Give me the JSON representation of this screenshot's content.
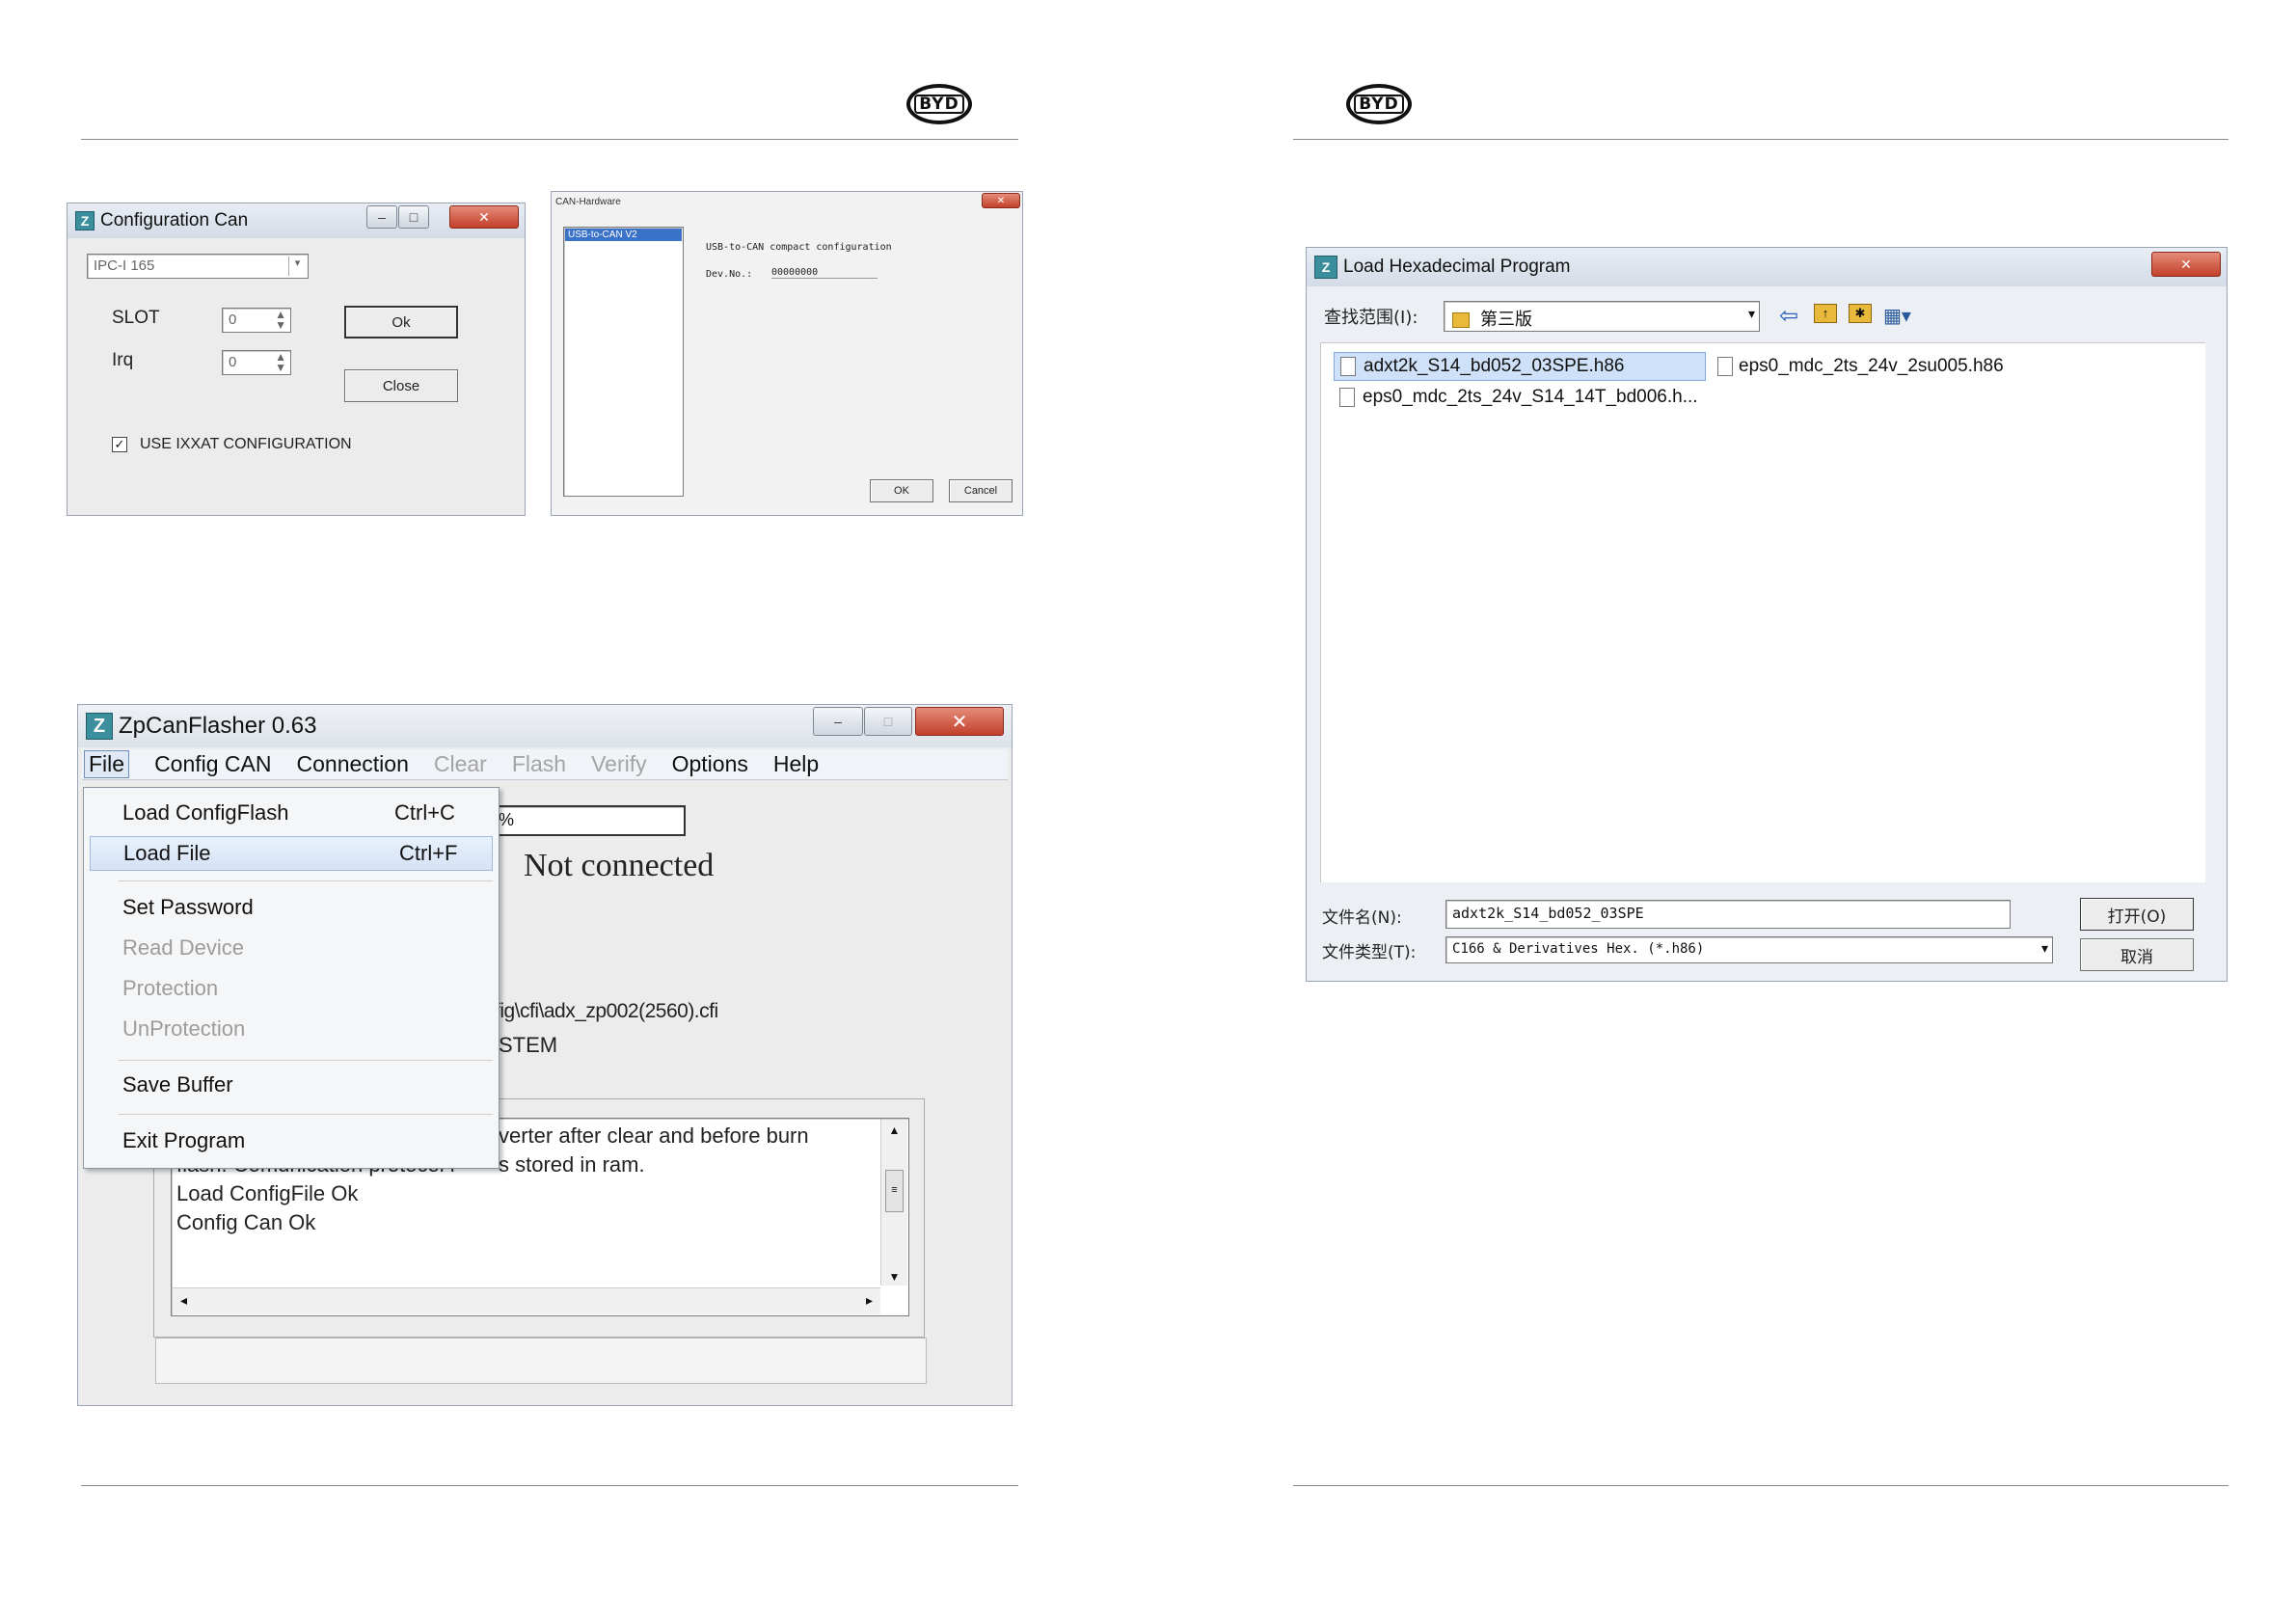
{
  "left_page": {
    "config_can": {
      "title": "Configuration Can",
      "device_select": "IPC-I 165",
      "slot_label": "SLOT",
      "slot_value": "0",
      "irq_label": "Irq",
      "irq_value": "0",
      "ok_label": "Ok",
      "close_label": "Close",
      "use_ixxat_checked": true,
      "use_ixxat_label": "USE IXXAT CONFIGURATION"
    },
    "can_hardware": {
      "title": "CAN-Hardware",
      "list_selected": "USB-to-CAN V2",
      "config_title": "USB-to-CAN compact configuration",
      "dev_no_label": "Dev.No.:",
      "dev_no_value": "00000000",
      "ok_label": "OK",
      "cancel_label": "Cancel"
    },
    "zpcanflasher": {
      "title": "ZpCanFlasher 0.63",
      "menu": {
        "file": "File",
        "config_can": "Config CAN",
        "connection": "Connection",
        "clear": "Clear",
        "flash": "Flash",
        "verify": "Verify",
        "options": "Options",
        "help": "Help"
      },
      "file_menu": [
        {
          "label": "Load ConfigFlash",
          "shortcut": "Ctrl+C",
          "enabled": true
        },
        {
          "label": "Load File",
          "shortcut": "Ctrl+F",
          "enabled": true,
          "highlighted": true
        },
        {
          "label": "Set Password",
          "shortcut": "",
          "enabled": true
        },
        {
          "label": "Read Device",
          "shortcut": "",
          "enabled": false
        },
        {
          "label": "Protection",
          "shortcut": "",
          "enabled": false
        },
        {
          "label": "UnProtection",
          "shortcut": "",
          "enabled": false
        },
        {
          "label": "Save Buffer",
          "shortcut": "",
          "enabled": true
        },
        {
          "label": "Exit Program",
          "shortcut": "",
          "enabled": true
        }
      ],
      "progress_text": "0%",
      "status": "Not connected",
      "config_path_fragment": "fig\\cfi\\adx_zp002(2560).cfi",
      "system_fragment": "STEM",
      "log_lines": [
        "verter after clear and before burn",
        "s stored in ram.",
        "Load ConfigFile Ok",
        "Config Can Ok"
      ],
      "log_line2_covered": "flash. Comunication protocol i"
    }
  },
  "right_page": {
    "load_hex": {
      "title": "Load Hexadecimal Program",
      "look_in_label": "查找范围(I):",
      "folder": "第三版",
      "files": [
        "adxt2k_S14_bd052_03SPE.h86",
        "eps0_mdc_2ts_24v_2su005.h86",
        "eps0_mdc_2ts_24v_S14_14T_bd006.h..."
      ],
      "selected_file_index": 0,
      "filename_label": "文件名(N):",
      "filename_value": "adxt2k_S14_bd052_03SPE",
      "filetype_label": "文件类型(T):",
      "filetype_value": "C166 & Derivatives Hex. (*.h86)",
      "open_label": "打开(O)",
      "cancel_label": "取消"
    }
  },
  "colors": {
    "selection": "#cfe1f8",
    "accent_close": "#c2402a",
    "disabled_text": "#a4a4a4"
  }
}
